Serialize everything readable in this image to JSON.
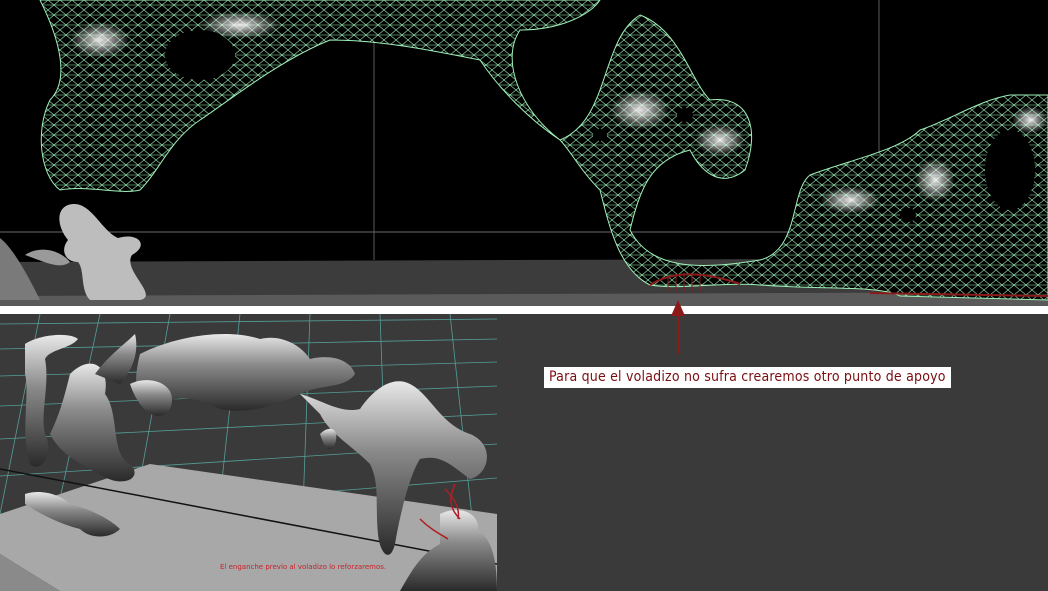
{
  "annotations": {
    "callout": "Para que el voladizo no sufra crearemos otro punto de apoyo",
    "note": "El enganche previo al voladizo lo reforzaremos."
  },
  "colors": {
    "wireframe": "#9ef0b8",
    "annotation_red": "#8b1a1a",
    "grid_cyan": "#5fc9c0"
  }
}
